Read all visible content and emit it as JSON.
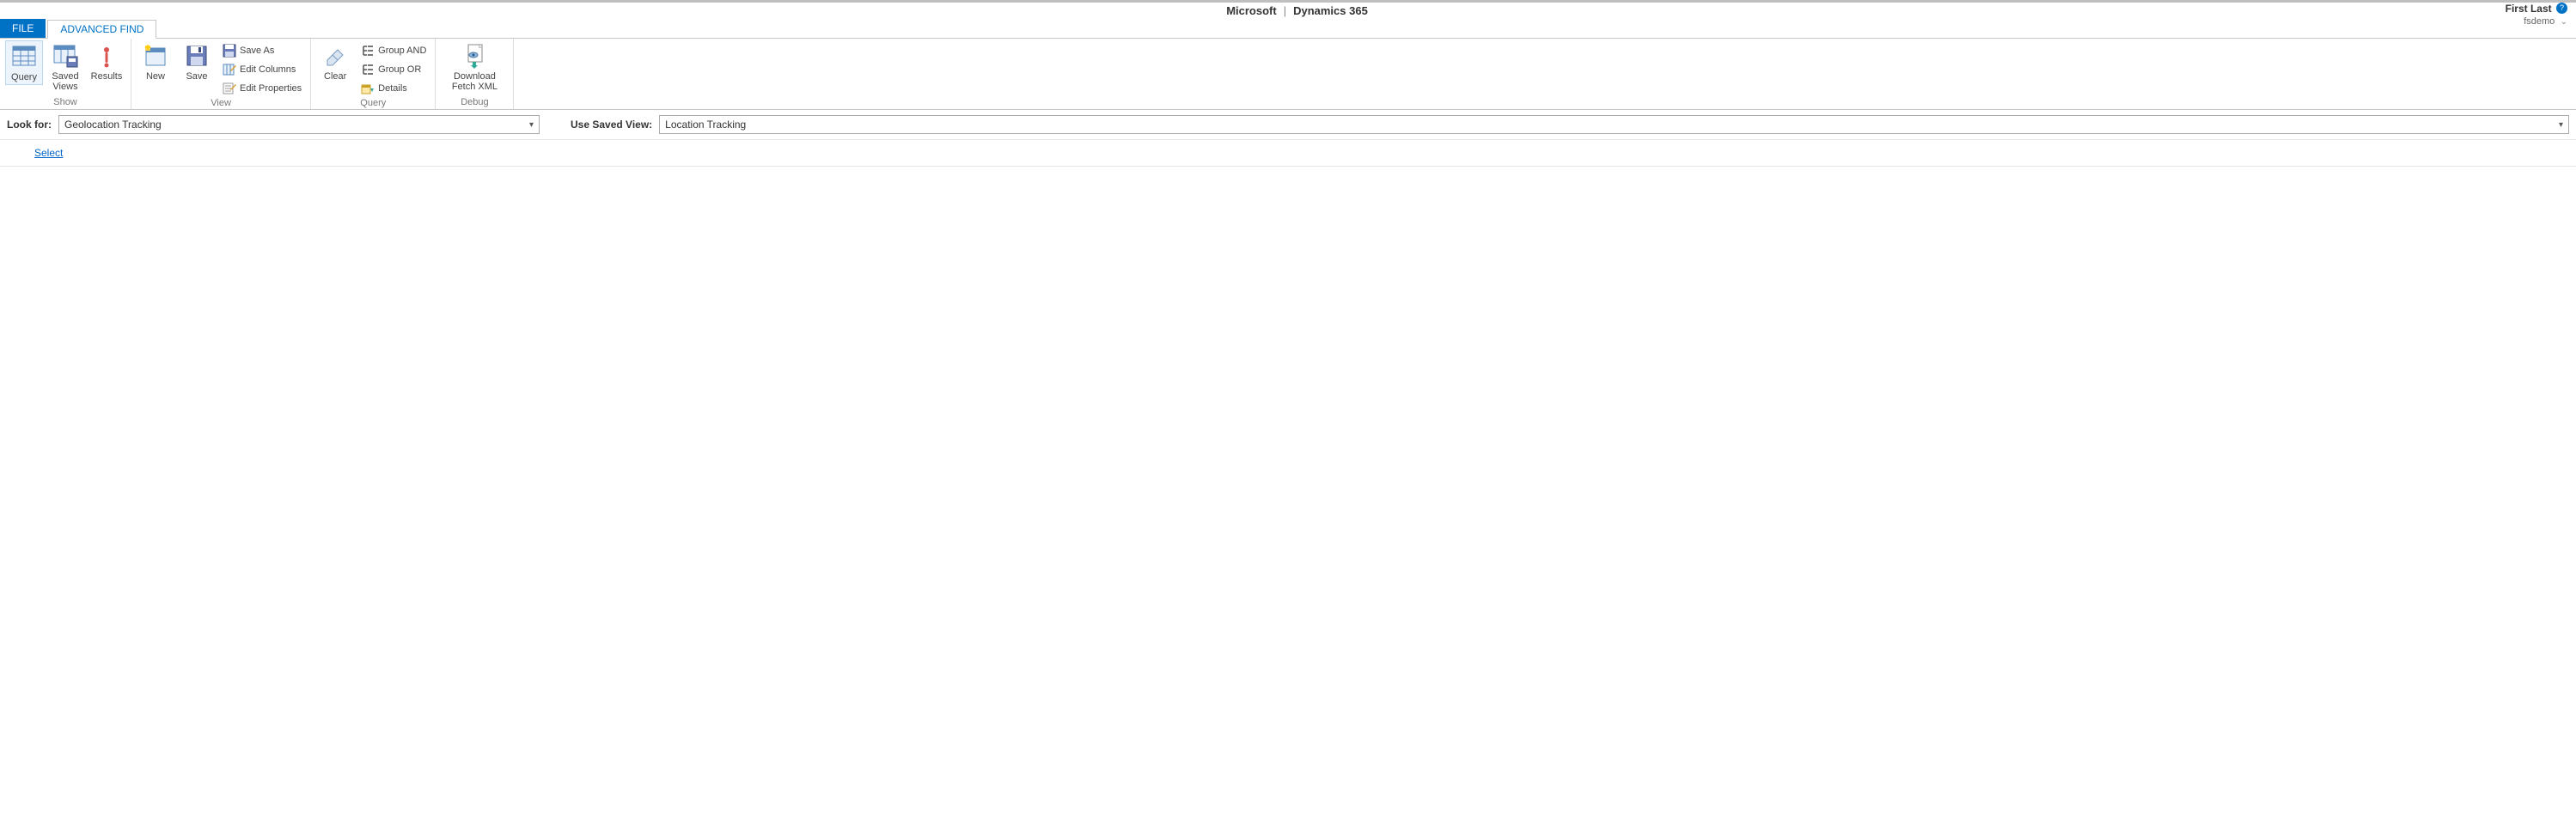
{
  "header": {
    "brand_left": "Microsoft",
    "brand_right": "Dynamics 365",
    "user_name": "First Last",
    "org_name": "fsdemo"
  },
  "tabs": {
    "file": "FILE",
    "advanced_find": "ADVANCED FIND"
  },
  "ribbon": {
    "groups": {
      "show": {
        "label": "Show",
        "query": "Query",
        "saved_views": "Saved Views",
        "results": "Results"
      },
      "view": {
        "label": "View",
        "new": "New",
        "save": "Save",
        "save_as": "Save As",
        "edit_columns": "Edit Columns",
        "edit_properties": "Edit Properties"
      },
      "query": {
        "label": "Query",
        "clear": "Clear",
        "group_and": "Group AND",
        "group_or": "Group OR",
        "details": "Details"
      },
      "debug": {
        "label": "Debug",
        "download_fetch_xml": "Download Fetch XML"
      }
    }
  },
  "filters": {
    "look_for_label": "Look for:",
    "look_for_value": "Geolocation Tracking",
    "use_saved_view_label": "Use Saved View:",
    "use_saved_view_value": "Location Tracking"
  },
  "query_builder": {
    "select_link": "Select"
  }
}
